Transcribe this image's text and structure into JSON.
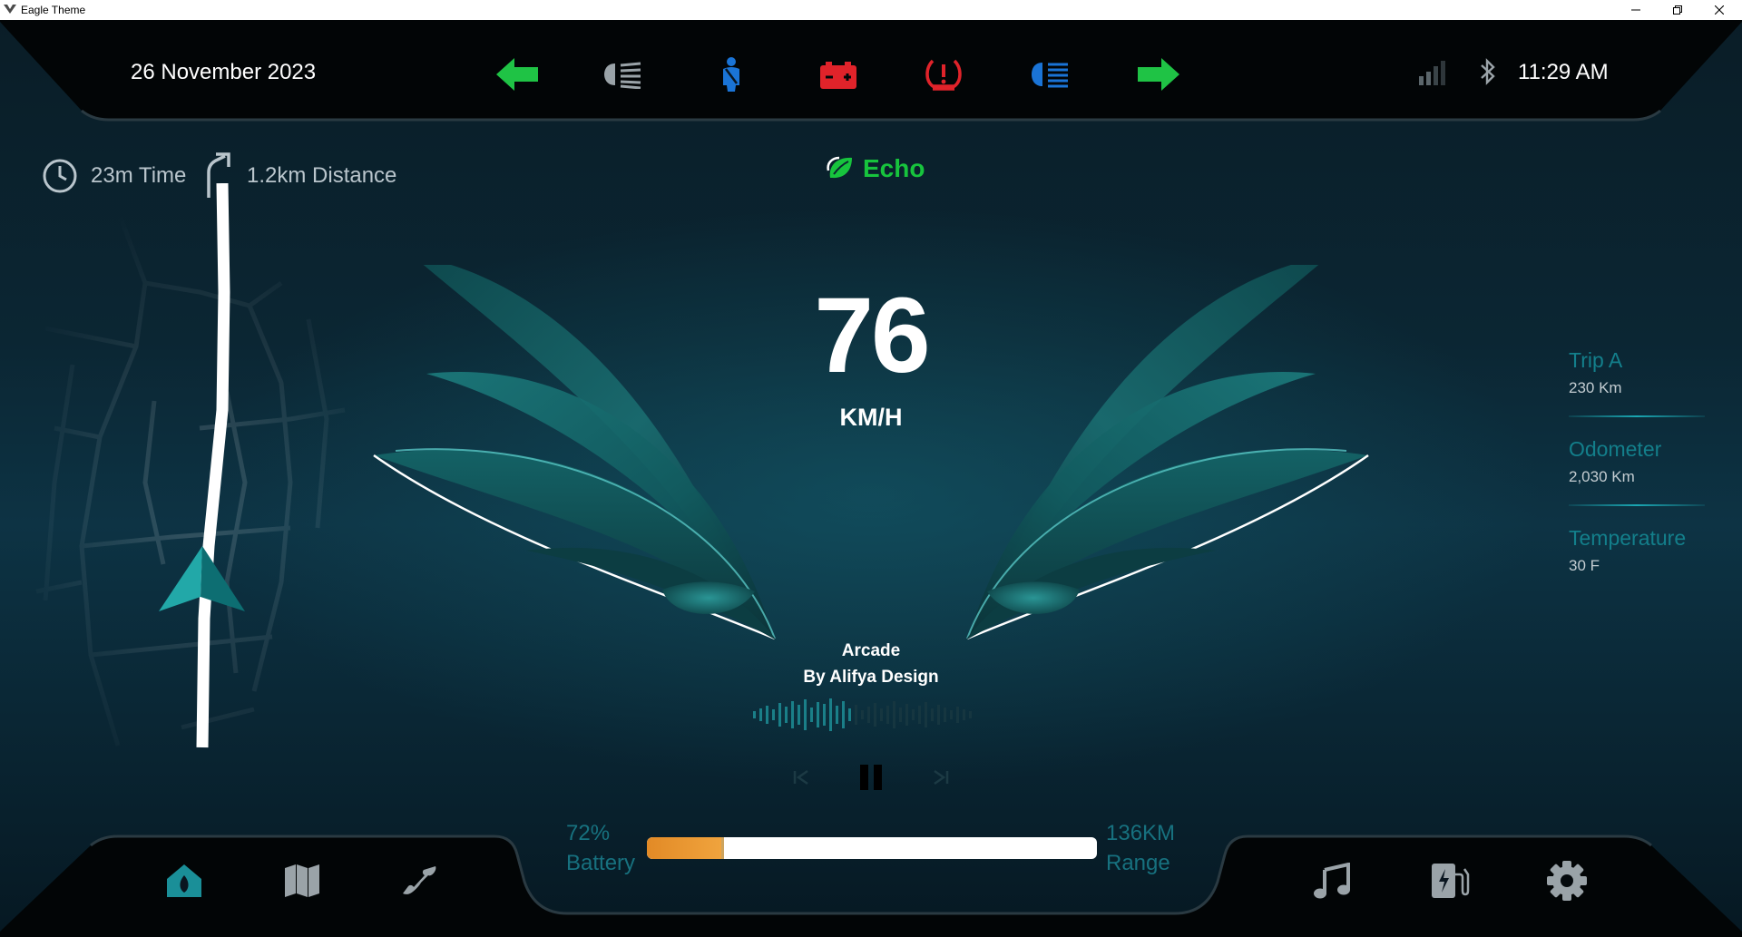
{
  "window": {
    "title": "Eagle Theme",
    "controls": [
      "minimize-icon",
      "restore-icon",
      "close-icon"
    ]
  },
  "header": {
    "date": "26 November 2023",
    "time": "11:29 AM",
    "status_icons": [
      "signal-icon",
      "bluetooth-icon"
    ]
  },
  "telltales": [
    {
      "name": "left-turn-signal-icon",
      "color": "#1fc345"
    },
    {
      "name": "low-beam-icon",
      "color": "#9aa3a8"
    },
    {
      "name": "seatbelt-icon",
      "color": "#1a74d6"
    },
    {
      "name": "battery-warning-icon",
      "color": "#e0232a"
    },
    {
      "name": "tire-pressure-warning-icon",
      "color": "#e0232a"
    },
    {
      "name": "high-beam-icon",
      "color": "#1a74d6"
    },
    {
      "name": "right-turn-signal-icon",
      "color": "#1fc345"
    }
  ],
  "navigation": {
    "time": "23m Time",
    "distance": "1.2km Distance"
  },
  "drive_mode": {
    "label": "Echo",
    "color": "#17c43d"
  },
  "speedometer": {
    "value": "76",
    "unit": "KM/H"
  },
  "media": {
    "title": "Arcade",
    "artist": "By Alifya Design",
    "controls": [
      "previous-track-icon",
      "pause-icon",
      "next-track-icon"
    ]
  },
  "trip_info": [
    {
      "label": "Trip A",
      "value": "230 Km"
    },
    {
      "label": "Odometer",
      "value": "2,030 Km"
    },
    {
      "label": "Temperature",
      "value": "30 F"
    }
  ],
  "battery": {
    "percent_text": "72%",
    "label": "Battery",
    "range_value": "136KM",
    "range_label": "Range",
    "bar_orange_fraction": 0.17
  },
  "bottom_nav": {
    "left": [
      "home-icon",
      "map-icon",
      "phone-icon"
    ],
    "right": [
      "music-icon",
      "charging-station-icon",
      "settings-icon"
    ],
    "active": "home-icon",
    "active_color": "#1a8f98"
  },
  "colors": {
    "accent_teal": "#137f8b",
    "turn_green": "#1fc345",
    "warning_red": "#e0232a",
    "info_blue": "#1a74d6",
    "battery_orange": "#e28a26"
  }
}
